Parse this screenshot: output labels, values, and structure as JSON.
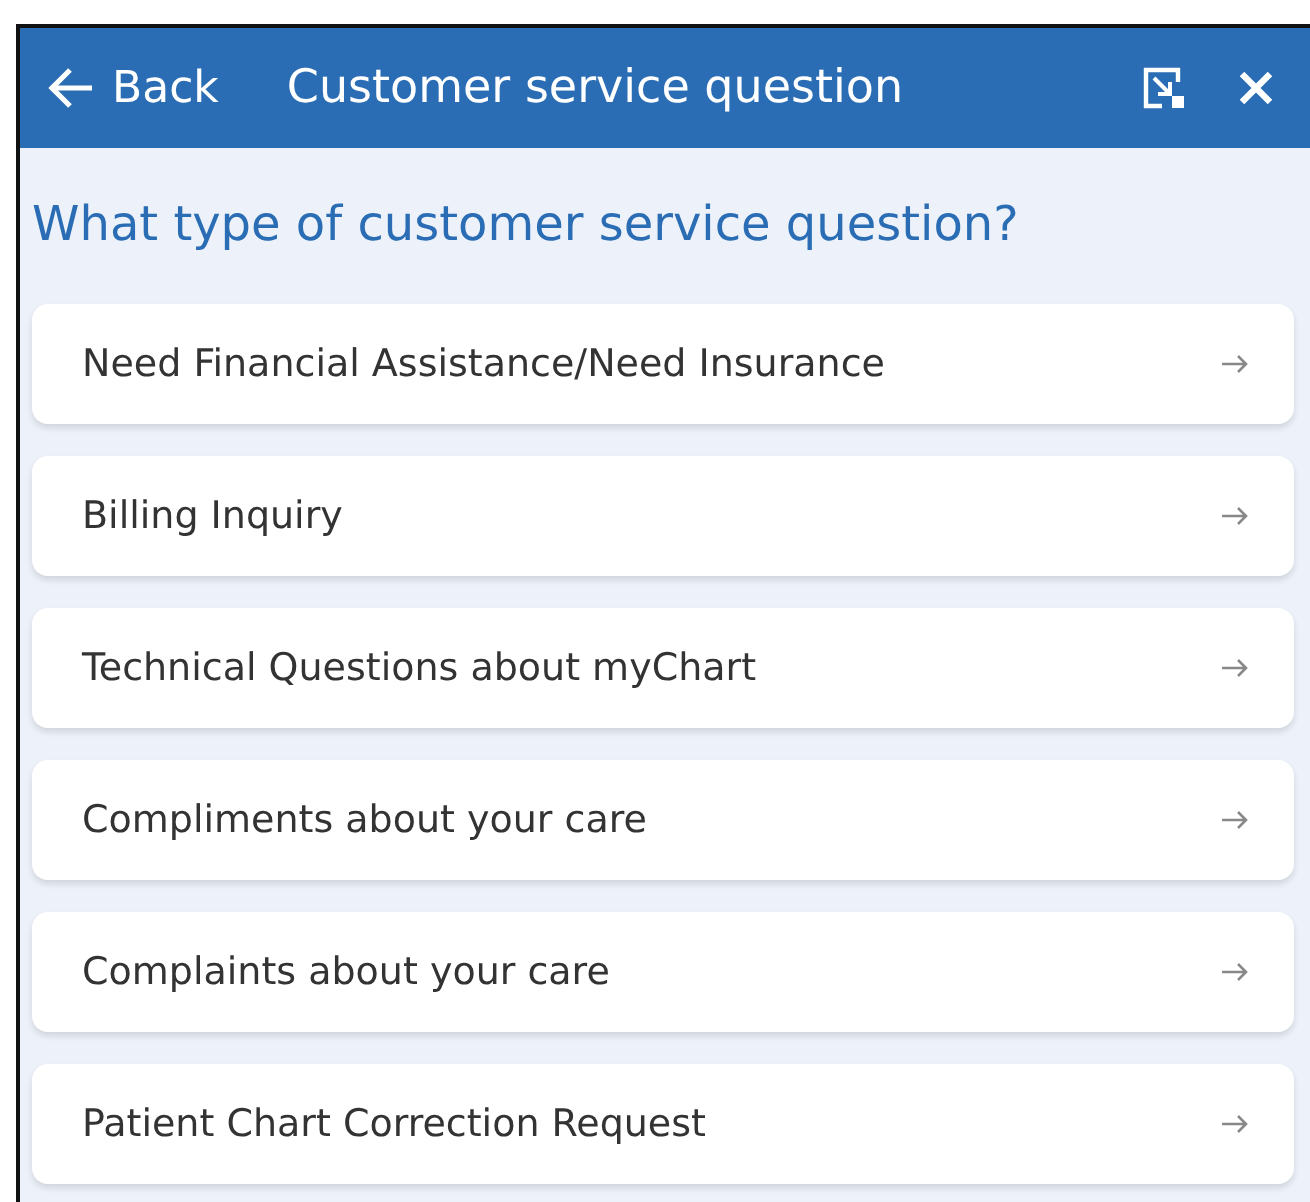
{
  "header": {
    "back": "Back",
    "title": "Customer service question"
  },
  "question": "What type of customer service question?",
  "options": [
    {
      "label": "Need Financial Assistance/Need Insurance"
    },
    {
      "label": "Billing Inquiry"
    },
    {
      "label": "Technical Questions about myChart"
    },
    {
      "label": "Compliments about your care"
    },
    {
      "label": "Complaints about your care"
    },
    {
      "label": "Patient Chart Correction Request"
    }
  ]
}
